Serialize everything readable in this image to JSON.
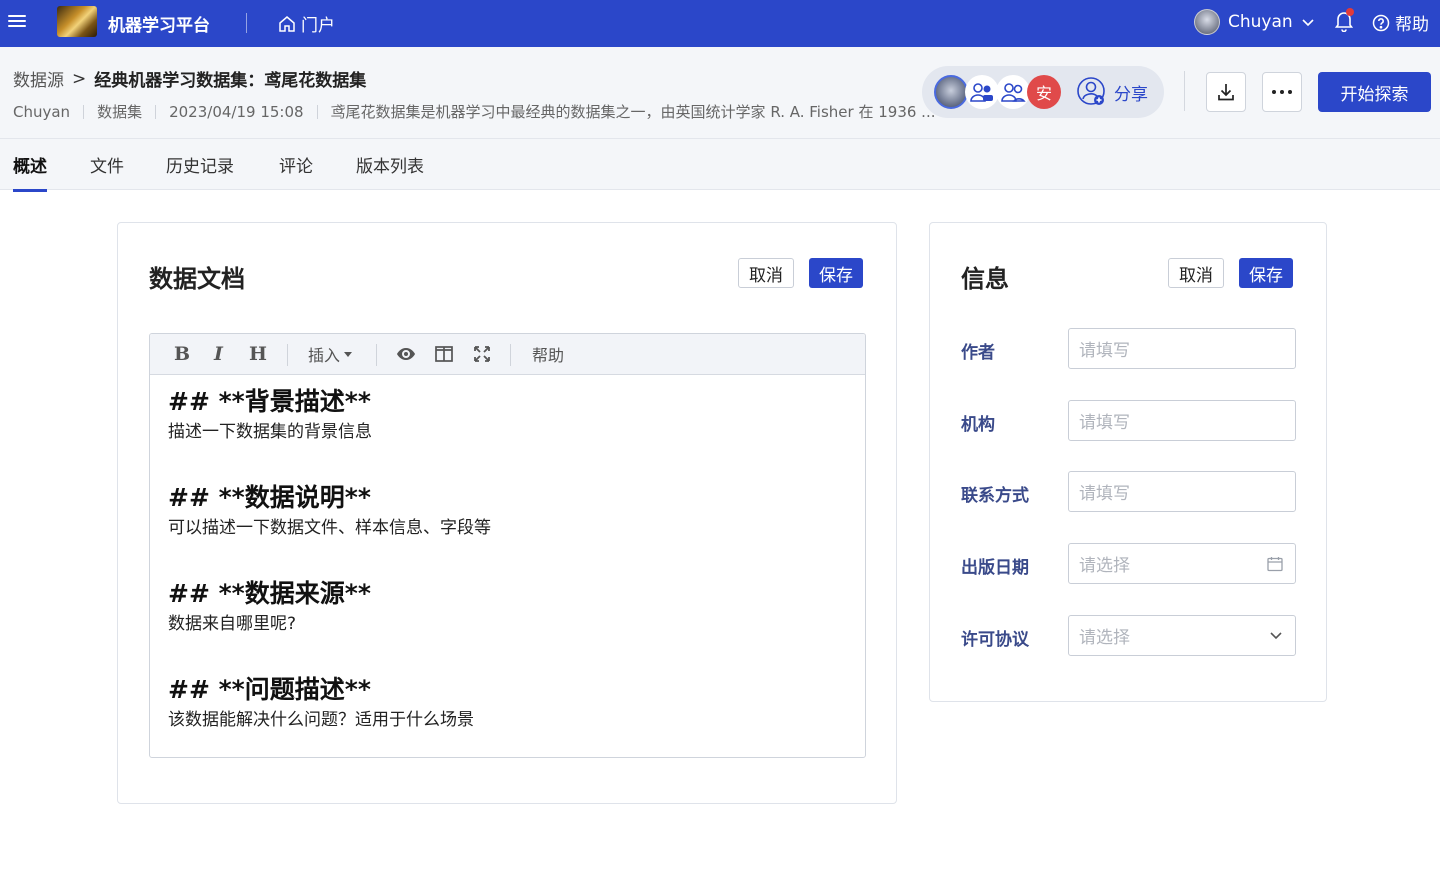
{
  "topbar": {
    "app_title": "机器学习平台",
    "portal_label": "门户",
    "user_name": "Chuyan",
    "help_label": "帮助"
  },
  "header": {
    "breadcrumb_root": "数据源",
    "breadcrumb_sep": ">",
    "breadcrumb_current": "经典机器学习数据集：鸢尾花数据集",
    "owner": "Chuyan",
    "type": "数据集",
    "updated": "2023/04/19 15:08",
    "description": "鸢尾花数据集是机器学习中最经典的数据集之一，由英国统计学家 R. A. Fisher 在 1936 ...",
    "collaborator_initial": "安",
    "share_label": "分享",
    "explore_label": "开始探索"
  },
  "tabs": [
    {
      "label": "概述",
      "active": true
    },
    {
      "label": "文件",
      "active": false
    },
    {
      "label": "历史记录",
      "active": false
    },
    {
      "label": "评论",
      "active": false
    },
    {
      "label": "版本列表",
      "active": false
    }
  ],
  "doc_card": {
    "title": "数据文档",
    "cancel_label": "取消",
    "save_label": "保存",
    "toolbar": {
      "bold": "B",
      "italic": "I",
      "heading": "H",
      "insert": "插入",
      "help": "帮助"
    },
    "sections": [
      {
        "heading": "## **背景描述**",
        "text": "描述一下数据集的背景信息"
      },
      {
        "heading": "## **数据说明**",
        "text": "可以描述一下数据文件、样本信息、字段等"
      },
      {
        "heading": "## **数据来源**",
        "text": "数据来自哪里呢?"
      },
      {
        "heading": "## **问题描述**",
        "text": "该数据能解决什么问题？适用于什么场景"
      }
    ]
  },
  "info_card": {
    "title": "信息",
    "cancel_label": "取消",
    "save_label": "保存",
    "fields": [
      {
        "label": "作者",
        "placeholder": "请填写"
      },
      {
        "label": "机构",
        "placeholder": "请填写"
      },
      {
        "label": "联系方式",
        "placeholder": "请填写"
      },
      {
        "label": "出版日期",
        "placeholder": "请选择"
      },
      {
        "label": "许可协议",
        "placeholder": "请选择"
      }
    ]
  },
  "colors": {
    "brand": "#2b47c9",
    "notification_dot": "#e23a3a",
    "avatar_an": "#e04a4a"
  }
}
